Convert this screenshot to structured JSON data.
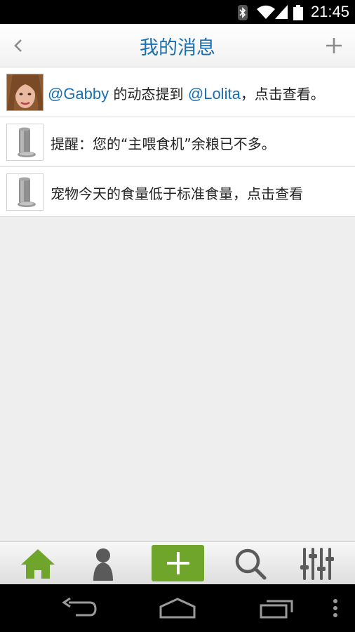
{
  "status_bar": {
    "time": "21:45",
    "icons": [
      "bluetooth-icon",
      "wifi-icon",
      "signal-icon",
      "battery-icon"
    ]
  },
  "header": {
    "title": "我的消息",
    "back_icon": "chevron-left-icon",
    "add_icon": "plus-icon"
  },
  "messages": [
    {
      "avatar": "user-photo",
      "mention_from": "@Gabby",
      "text_mid": " 的动态提到 ",
      "mention_to": "@Lolita",
      "text_end": "，点击查看。"
    },
    {
      "avatar": "feeder-device-image",
      "text": "提醒：您的“主喂食机”余粮已不多。"
    },
    {
      "avatar": "feeder-device-image",
      "text": "宠物今天的食量低于标准食量，点击查看"
    }
  ],
  "tabbar": {
    "tabs": [
      "home-icon",
      "profile-icon",
      "add-icon",
      "search-icon",
      "settings-sliders-icon"
    ],
    "active_color": "#6fa52a",
    "inactive_color": "#555555"
  },
  "navbar": {
    "icons": [
      "back-nav-icon",
      "home-nav-icon",
      "recent-apps-icon",
      "overflow-menu-icon"
    ]
  }
}
